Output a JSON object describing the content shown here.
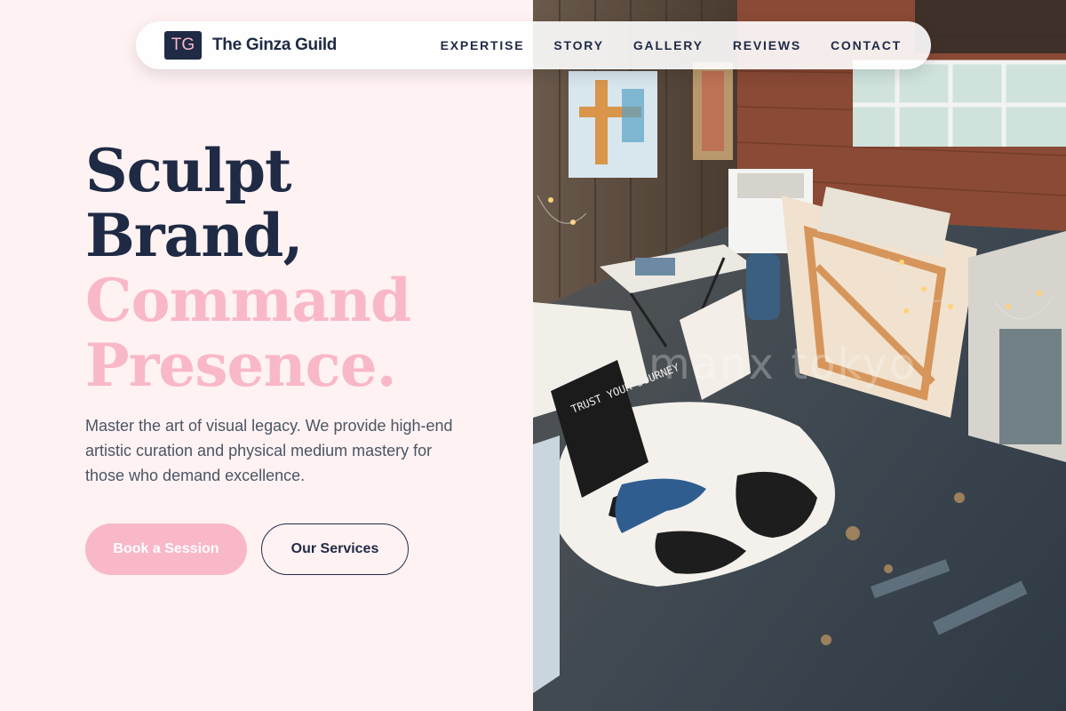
{
  "nav": {
    "logo_text": "TG",
    "brand": "The Ginza Guild",
    "links": [
      "EXPERTISE",
      "STORY",
      "GALLERY",
      "REVIEWS",
      "CONTACT"
    ]
  },
  "hero": {
    "headline_line1": "Sculpt",
    "headline_line2": "Brand,",
    "headline_line3": "Command",
    "headline_line4": "Presence.",
    "subtext": "Master the art of visual legacy. We provide high-end artistic curation and physical medium mastery for those who demand excellence.",
    "primary_cta": "Book a Session",
    "secondary_cta": "Our Services"
  },
  "photo": {
    "watermark": "manx tokyo",
    "sign_text": "TRUST YOUR JOURNEY"
  },
  "colors": {
    "navy": "#1f2a44",
    "pink": "#f9b8c8",
    "background": "#fff2f3",
    "body_text": "#4b5563"
  }
}
